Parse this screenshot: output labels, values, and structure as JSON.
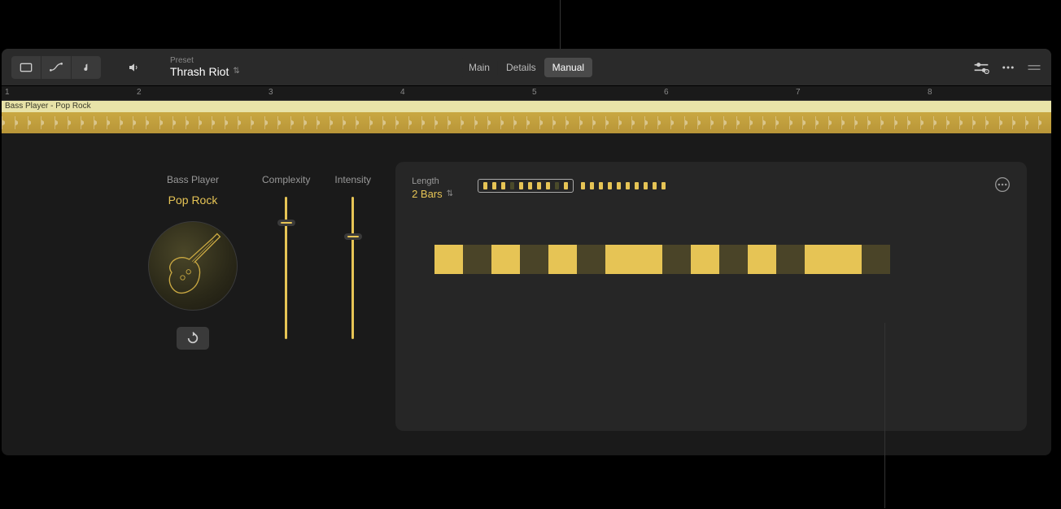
{
  "toolbar": {
    "preset_label": "Preset",
    "preset_value": "Thrash Riot"
  },
  "tabs": [
    {
      "label": "Main"
    },
    {
      "label": "Details"
    },
    {
      "label": "Manual",
      "active": true
    }
  ],
  "timeline": {
    "markers": [
      "1",
      "2",
      "3",
      "4",
      "5",
      "6",
      "7",
      "8"
    ]
  },
  "track": {
    "region_name": "Bass Player - Pop Rock"
  },
  "player": {
    "type_label": "Bass Player",
    "style_label": "Pop Rock"
  },
  "sliders": {
    "complexity_label": "Complexity",
    "complexity_value": 82,
    "intensity_label": "Intensity",
    "intensity_value": 72
  },
  "pattern": {
    "length_label": "Length",
    "length_value": "2 Bars",
    "beat_group1": [
      true,
      true,
      true,
      false,
      true,
      true,
      true,
      true,
      false,
      true
    ],
    "beat_group2": [
      true,
      true,
      true,
      true,
      true,
      true,
      true,
      true,
      true,
      true
    ],
    "steps": [
      true,
      false,
      true,
      false,
      true,
      false,
      true,
      true,
      false,
      true,
      false,
      true,
      false,
      true,
      true,
      false
    ]
  }
}
